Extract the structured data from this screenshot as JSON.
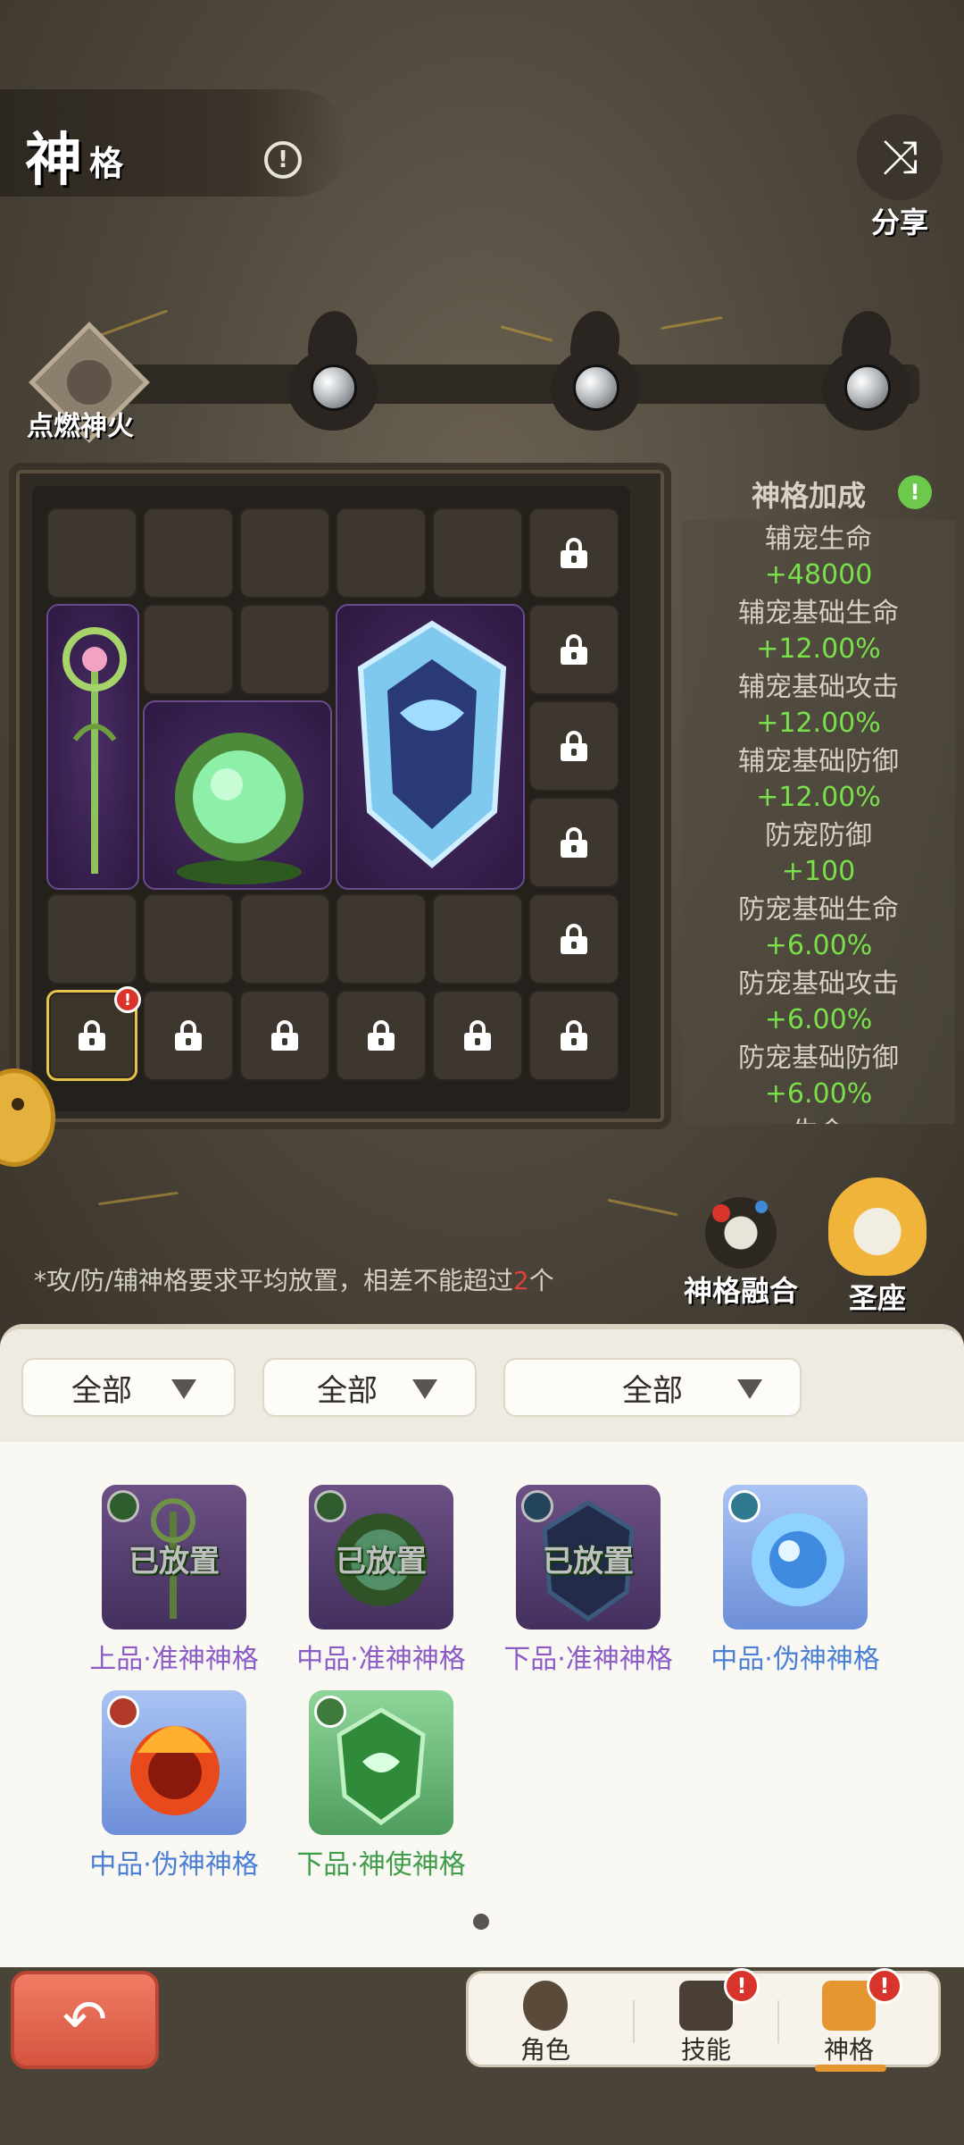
{
  "header": {
    "title_big": "神",
    "title_small": "格",
    "info_icon": "info-icon",
    "share_label": "分享",
    "share_icon": "shuffle-icon"
  },
  "fire_track": {
    "ignite_label": "点燃神火",
    "nodes": 3
  },
  "bonus": {
    "title": "神格加成",
    "rows": [
      {
        "name": "辅宠生命",
        "value": "+48000"
      },
      {
        "name": "辅宠基础生命",
        "value": "+12.00%"
      },
      {
        "name": "辅宠基础攻击",
        "value": "+12.00%"
      },
      {
        "name": "辅宠基础防御",
        "value": "+12.00%"
      },
      {
        "name": "防宠防御",
        "value": "+100"
      },
      {
        "name": "防宠基础生命",
        "value": "+6.00%"
      },
      {
        "name": "防宠基础攻击",
        "value": "+6.00%"
      },
      {
        "name": "防宠基础防御",
        "value": "+6.00%"
      },
      {
        "name": "生命",
        "value": ""
      }
    ]
  },
  "actions": {
    "fusion_label": "神格融合",
    "throne_label": "圣座"
  },
  "hint": {
    "prefix": "*攻/防/辅神格要求平均放置，相差不能超过",
    "count": "2",
    "suffix": "个"
  },
  "filters": [
    {
      "label": "全部"
    },
    {
      "label": "全部"
    },
    {
      "label": "全部"
    }
  ],
  "inventory": [
    {
      "name": "上品·准神神格",
      "placed": "已放置",
      "tier": "purple"
    },
    {
      "name": "中品·准神神格",
      "placed": "已放置",
      "tier": "purple"
    },
    {
      "name": "下品·准神神格",
      "placed": "已放置",
      "tier": "purple"
    },
    {
      "name": "中品·伪神神格",
      "placed": "",
      "tier": "blue"
    },
    {
      "name": "中品·伪神神格",
      "placed": "",
      "tier": "blue"
    },
    {
      "name": "下品·神使神格",
      "placed": "",
      "tier": "green"
    }
  ],
  "nav": {
    "back_icon": "back-arrow-icon",
    "tabs": [
      {
        "label": "角色",
        "icon": "character-icon",
        "badge": ""
      },
      {
        "label": "技能",
        "icon": "skill-book-icon",
        "badge": "!"
      },
      {
        "label": "神格",
        "icon": "divinity-icon",
        "badge": "!"
      }
    ]
  }
}
